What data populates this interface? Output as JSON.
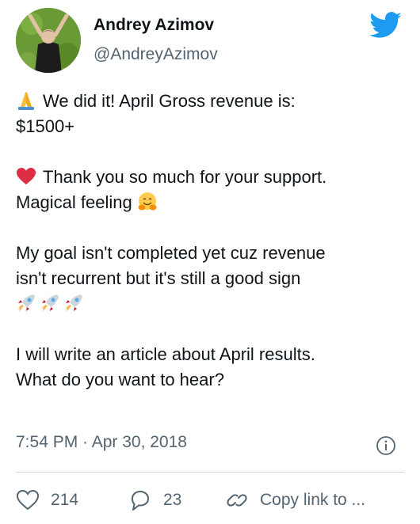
{
  "author": {
    "name": "Andrey Azimov",
    "handle": "@AndreyAzimov"
  },
  "tweet": {
    "paragraphs": [
      {
        "line1": "We did it! April Gross revenue is:",
        "line2": "$1500+",
        "lead_emoji": "folded-hands-icon"
      },
      {
        "line1": "Thank you so much for your support.",
        "line2": "Magical feeling",
        "lead_emoji": "red-heart-icon",
        "trail_emoji": "hugging-face-icon"
      },
      {
        "line1": "My goal isn't completed yet cuz revenue",
        "line2": "isn't recurrent but it's still a good sign",
        "trail_emoji": "rocket-icon x3"
      },
      {
        "line1": "I will write an article about April results.",
        "line2": "What do you want to hear?"
      }
    ]
  },
  "meta": {
    "timestamp": "7:54 PM · Apr 30, 2018"
  },
  "actions": {
    "likes": "214",
    "replies": "23",
    "copy_link_label": "Copy link to ..."
  },
  "colors": {
    "twitter_blue": "#1d9bf0",
    "text": "#0f1419",
    "secondary": "#536471",
    "divider": "#cfd9de"
  }
}
